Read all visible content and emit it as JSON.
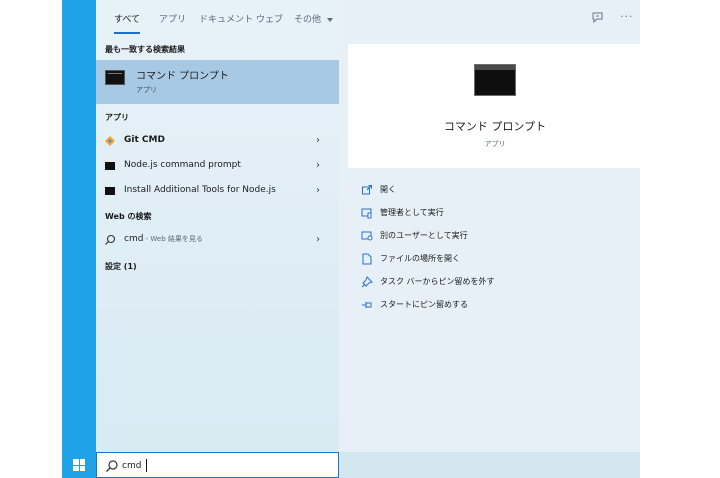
{
  "filter_tabs": [
    {
      "label": "すべて",
      "active": true
    },
    {
      "label": "アプリ"
    },
    {
      "label": "ドキュメント"
    },
    {
      "label": "ウェブ"
    },
    {
      "label": "その他"
    }
  ],
  "more_label": "···",
  "best_match": {
    "header": "最も一致する検索結果",
    "title": "コマンド プロンプト",
    "subtitle": "アプリ"
  },
  "apps": {
    "header": "アプリ",
    "items": [
      {
        "label_bold": "Git CMD",
        "icon": "git-icon"
      },
      {
        "label": "Node.js command prompt",
        "icon": "terminal-icon"
      },
      {
        "label": "Install Additional Tools for Node.js",
        "icon": "terminal-icon"
      }
    ]
  },
  "web": {
    "header": "Web の検索",
    "query": "cmd",
    "suffix": " - Web 結果を見る"
  },
  "settings": {
    "header": "設定 (1)"
  },
  "preview": {
    "title": "コマンド プロンプト",
    "subtitle": "アプリ"
  },
  "actions": [
    {
      "label": "開く",
      "icon": "open-icon"
    },
    {
      "label": "管理者として実行",
      "icon": "run-as-admin-icon"
    },
    {
      "label": "別のユーザーとして実行",
      "icon": "run-as-other-user-icon"
    },
    {
      "label": "ファイルの場所を開く",
      "icon": "file-location-icon"
    },
    {
      "label": "タスク バーからピン留めを外す",
      "icon": "unpin-taskbar-icon"
    },
    {
      "label": "スタートにピン留めする",
      "icon": "pin-start-icon"
    }
  ],
  "search": {
    "value": "cmd"
  },
  "colors": {
    "accent": "#1f6fd0",
    "taskbar": "#1fa2e8",
    "selection": "#a7c9e4"
  }
}
